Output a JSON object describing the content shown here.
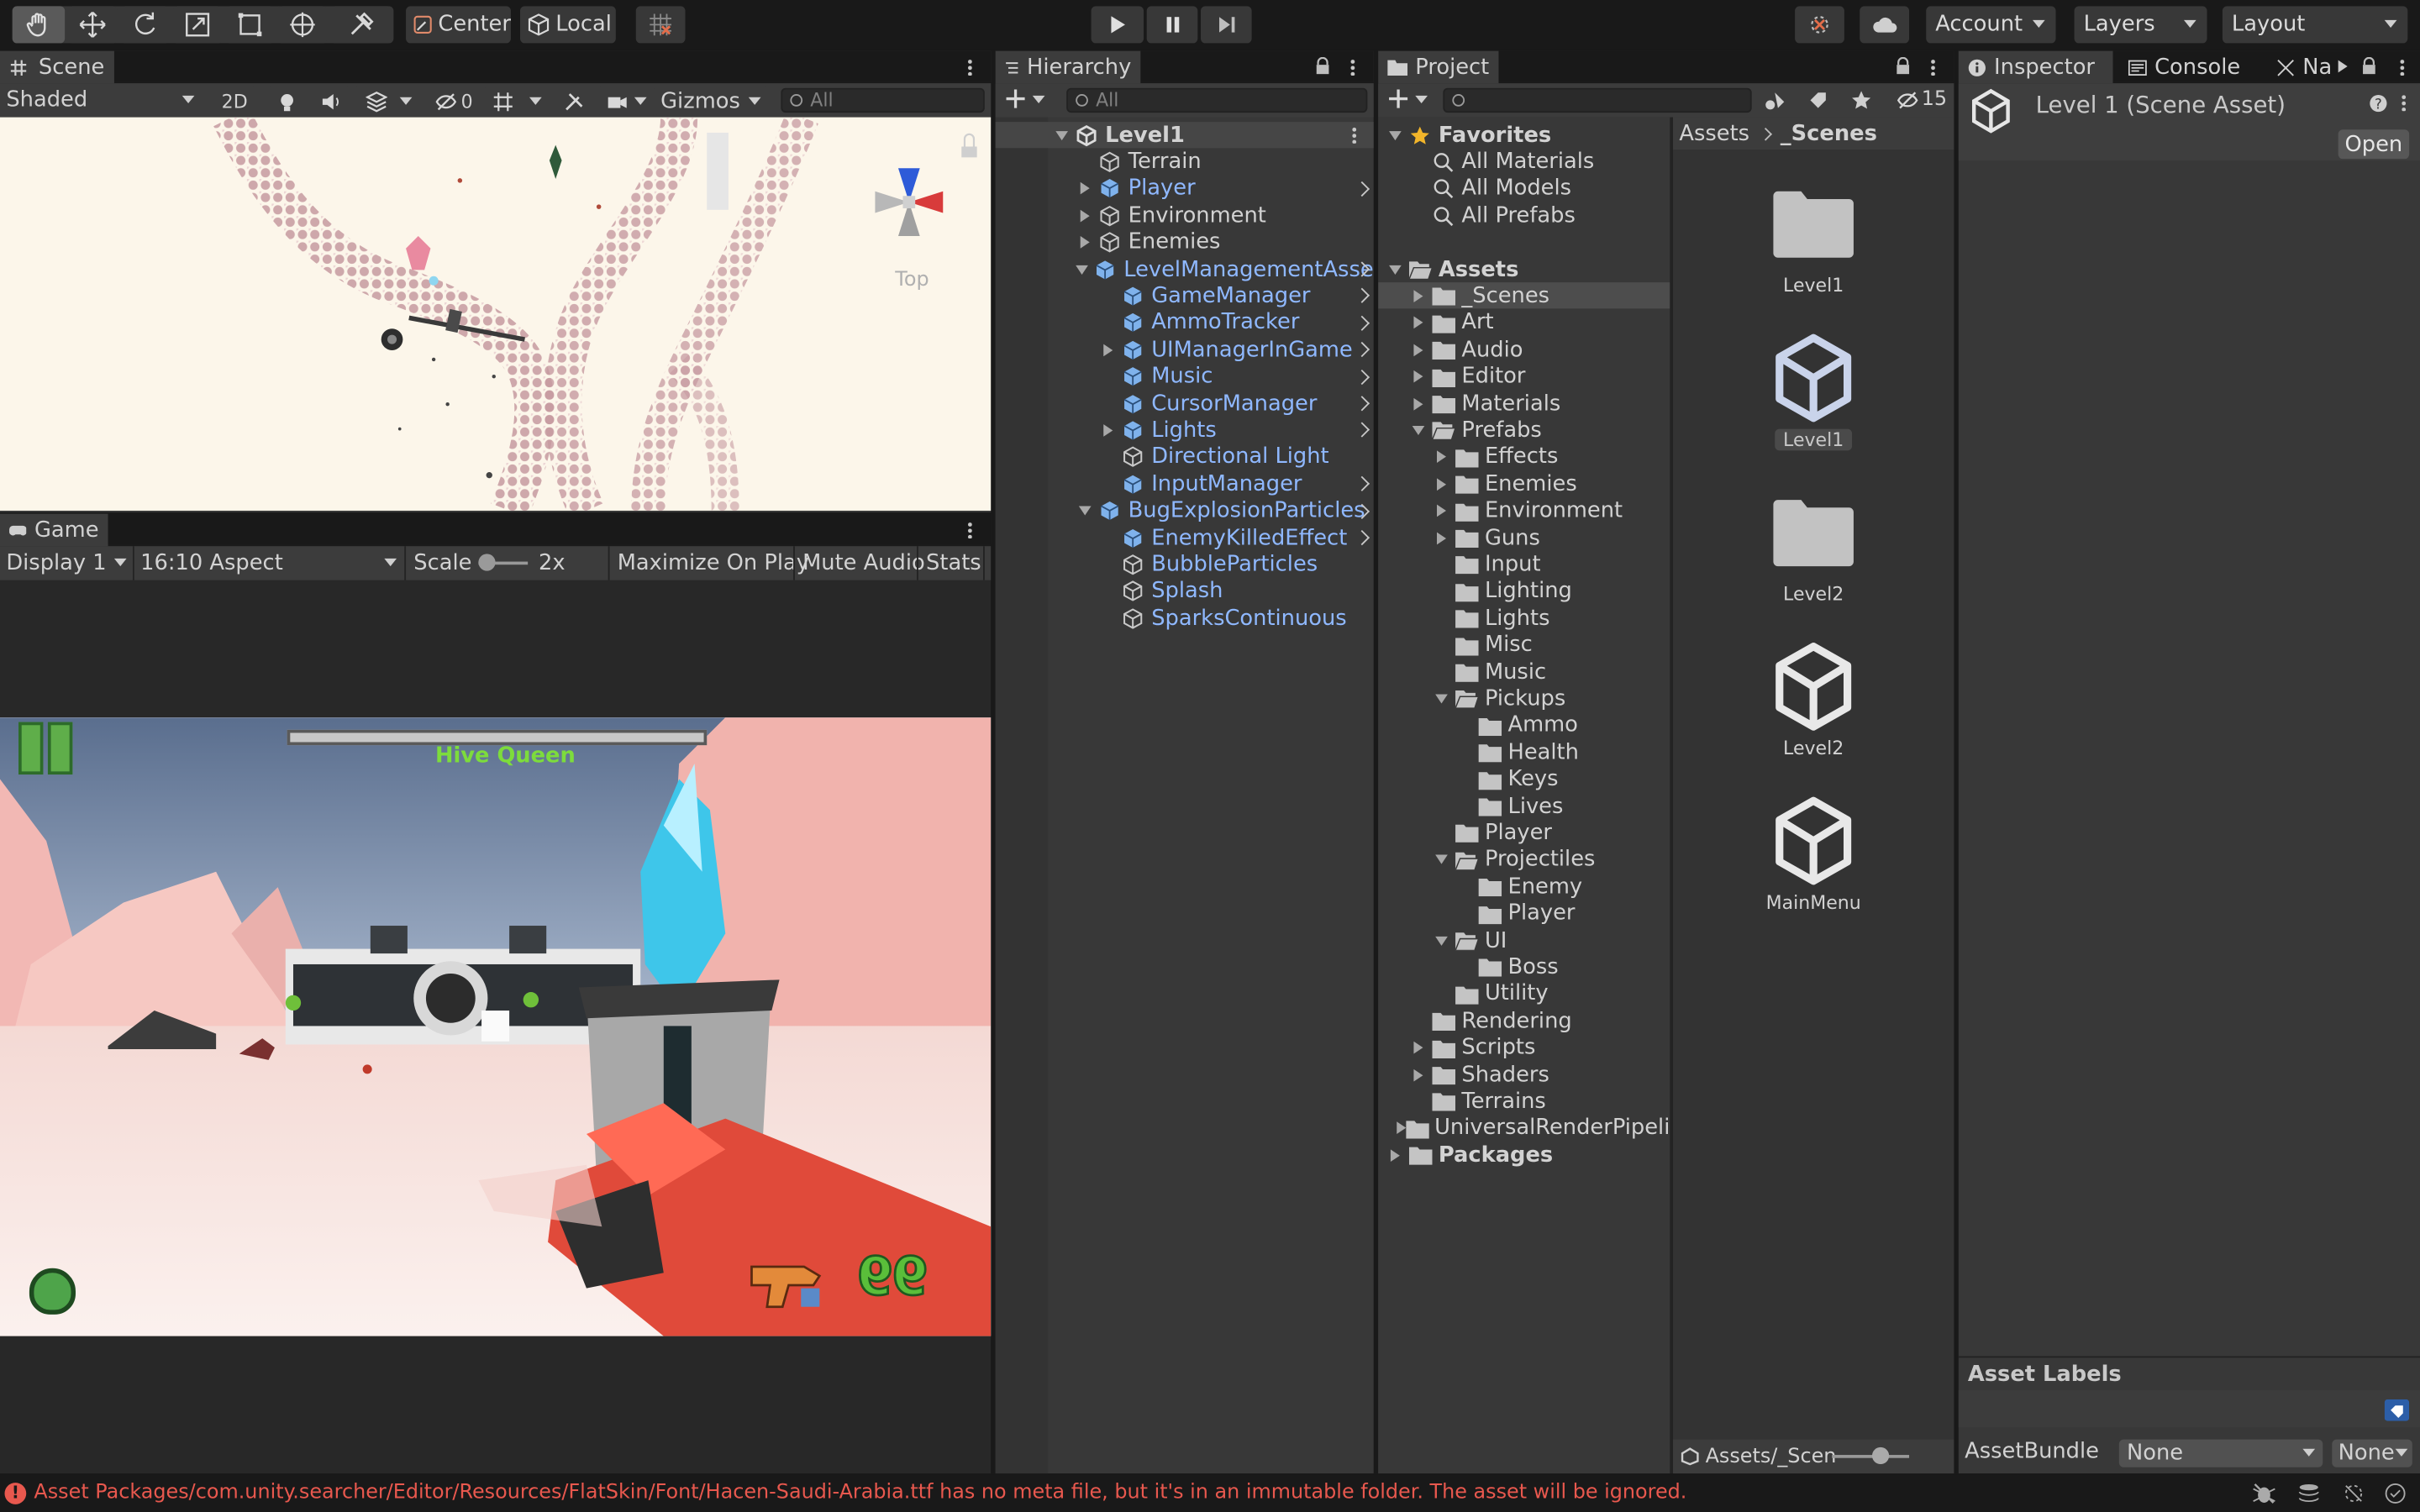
{
  "toolbar": {
    "pivot": "Center",
    "space": "Local",
    "account": "Account",
    "layers": "Layers",
    "layout": "Layout"
  },
  "scene": {
    "tab": "Scene",
    "shading": "Shaded",
    "mode_2d": "2D",
    "hidden_count": "0",
    "gizmos": "Gizmos",
    "search_placeholder": "All",
    "gizmo_label": "Top"
  },
  "game": {
    "tab": "Game",
    "display": "Display 1",
    "aspect": "16:10 Aspect",
    "scale_label": "Scale",
    "scale_value": "2x",
    "maximize": "Maximize On Play",
    "mute": "Mute Audio",
    "stats": "Stats",
    "boss_name": "Hive Queen",
    "ammo": "99"
  },
  "hierarchy": {
    "tab": "Hierarchy",
    "search_placeholder": "All",
    "items": [
      {
        "label": "Level1",
        "depth": 0,
        "icon": "unity-scene-icon",
        "expanded": true,
        "bold": true,
        "kebab": true
      },
      {
        "label": "Terrain",
        "depth": 1,
        "icon": "gameobject-icon"
      },
      {
        "label": "Player",
        "depth": 1,
        "icon": "prefab-icon",
        "collapsed": true,
        "blue": true,
        "chevron": true
      },
      {
        "label": "Environment",
        "depth": 1,
        "icon": "gameobject-icon",
        "collapsed": true
      },
      {
        "label": "Enemies",
        "depth": 1,
        "icon": "gameobject-icon",
        "collapsed": true
      },
      {
        "label": "LevelManagementAsse",
        "depth": 1,
        "icon": "prefab-icon",
        "expanded": true,
        "blue": true,
        "chevron": true
      },
      {
        "label": "GameManager",
        "depth": 2,
        "icon": "prefab-icon",
        "blue": true,
        "chevron": true
      },
      {
        "label": "AmmoTracker",
        "depth": 2,
        "icon": "prefab-icon",
        "blue": true,
        "chevron": true
      },
      {
        "label": "UIManagerInGame",
        "depth": 2,
        "icon": "prefab-icon",
        "collapsed": true,
        "blue": true,
        "chevron": true
      },
      {
        "label": "Music",
        "depth": 2,
        "icon": "prefab-icon",
        "blue": true,
        "chevron": true
      },
      {
        "label": "CursorManager",
        "depth": 2,
        "icon": "prefab-icon",
        "blue": true,
        "chevron": true
      },
      {
        "label": "Lights",
        "depth": 2,
        "icon": "prefab-icon",
        "collapsed": true,
        "blue": true,
        "chevron": true
      },
      {
        "label": "Directional Light",
        "depth": 2,
        "icon": "gameobject-icon",
        "blue": true
      },
      {
        "label": "InputManager",
        "depth": 2,
        "icon": "prefab-icon",
        "blue": true,
        "chevron": true
      },
      {
        "label": "BugExplosionParticles",
        "depth": 1,
        "icon": "prefab-icon",
        "expanded": true,
        "blue": true,
        "chevron": true
      },
      {
        "label": "EnemyKilledEffect",
        "depth": 2,
        "icon": "prefab-icon",
        "blue": true,
        "chevron": true
      },
      {
        "label": "BubbleParticles",
        "depth": 2,
        "icon": "gameobject-icon",
        "blue": true
      },
      {
        "label": "Splash",
        "depth": 2,
        "icon": "gameobject-icon",
        "blue": true
      },
      {
        "label": "SparksContinuous",
        "depth": 2,
        "icon": "gameobject-icon",
        "blue": true
      }
    ]
  },
  "project": {
    "tab": "Project",
    "hidden_count": "15",
    "breadcrumb": [
      "Assets",
      "_Scenes"
    ],
    "footer_path": "Assets/_Scen",
    "tree": [
      {
        "label": "Favorites",
        "depth": 0,
        "icon": "star-icon",
        "expanded": true,
        "bold": true
      },
      {
        "label": "All Materials",
        "depth": 1,
        "icon": "search-icon"
      },
      {
        "label": "All Models",
        "depth": 1,
        "icon": "search-icon"
      },
      {
        "label": "All Prefabs",
        "depth": 1,
        "icon": "search-icon"
      },
      {
        "label": "",
        "depth": 0,
        "icon": "none"
      },
      {
        "label": "Assets",
        "depth": 0,
        "icon": "folder-open-icon",
        "expanded": true,
        "bold": true
      },
      {
        "label": "_Scenes",
        "depth": 1,
        "icon": "folder-icon",
        "collapsed": true,
        "selected": true
      },
      {
        "label": "Art",
        "depth": 1,
        "icon": "folder-icon",
        "collapsed": true
      },
      {
        "label": "Audio",
        "depth": 1,
        "icon": "folder-icon",
        "collapsed": true
      },
      {
        "label": "Editor",
        "depth": 1,
        "icon": "folder-icon",
        "collapsed": true
      },
      {
        "label": "Materials",
        "depth": 1,
        "icon": "folder-icon",
        "collapsed": true
      },
      {
        "label": "Prefabs",
        "depth": 1,
        "icon": "folder-open-icon",
        "expanded": true
      },
      {
        "label": "Effects",
        "depth": 2,
        "icon": "folder-icon",
        "collapsed": true
      },
      {
        "label": "Enemies",
        "depth": 2,
        "icon": "folder-icon",
        "collapsed": true
      },
      {
        "label": "Environment",
        "depth": 2,
        "icon": "folder-icon",
        "collapsed": true
      },
      {
        "label": "Guns",
        "depth": 2,
        "icon": "folder-icon",
        "collapsed": true
      },
      {
        "label": "Input",
        "depth": 2,
        "icon": "folder-icon"
      },
      {
        "label": "Lighting",
        "depth": 2,
        "icon": "folder-icon"
      },
      {
        "label": "Lights",
        "depth": 2,
        "icon": "folder-icon"
      },
      {
        "label": "Misc",
        "depth": 2,
        "icon": "folder-icon"
      },
      {
        "label": "Music",
        "depth": 2,
        "icon": "folder-icon"
      },
      {
        "label": "Pickups",
        "depth": 2,
        "icon": "folder-open-icon",
        "expanded": true
      },
      {
        "label": "Ammo",
        "depth": 3,
        "icon": "folder-icon"
      },
      {
        "label": "Health",
        "depth": 3,
        "icon": "folder-icon"
      },
      {
        "label": "Keys",
        "depth": 3,
        "icon": "folder-icon"
      },
      {
        "label": "Lives",
        "depth": 3,
        "icon": "folder-icon"
      },
      {
        "label": "Player",
        "depth": 2,
        "icon": "folder-icon"
      },
      {
        "label": "Projectiles",
        "depth": 2,
        "icon": "folder-open-icon",
        "expanded": true
      },
      {
        "label": "Enemy",
        "depth": 3,
        "icon": "folder-icon"
      },
      {
        "label": "Player",
        "depth": 3,
        "icon": "folder-icon"
      },
      {
        "label": "UI",
        "depth": 2,
        "icon": "folder-open-icon",
        "expanded": true
      },
      {
        "label": "Boss",
        "depth": 3,
        "icon": "folder-icon"
      },
      {
        "label": "Utility",
        "depth": 2,
        "icon": "folder-icon"
      },
      {
        "label": "Rendering",
        "depth": 1,
        "icon": "folder-icon"
      },
      {
        "label": "Scripts",
        "depth": 1,
        "icon": "folder-icon",
        "collapsed": true
      },
      {
        "label": "Shaders",
        "depth": 1,
        "icon": "folder-icon",
        "collapsed": true
      },
      {
        "label": "Terrains",
        "depth": 1,
        "icon": "folder-icon"
      },
      {
        "label": "UniversalRenderPipeli",
        "depth": 1,
        "icon": "folder-icon",
        "collapsed": true
      },
      {
        "label": "Packages",
        "depth": 0,
        "icon": "folder-icon",
        "collapsed": true,
        "bold": true
      }
    ],
    "assets": [
      {
        "label": "Level1",
        "icon": "folder-icon"
      },
      {
        "label": "Level1",
        "icon": "unity-scene-icon",
        "selected": true
      },
      {
        "label": "Level2",
        "icon": "folder-icon"
      },
      {
        "label": "Level2",
        "icon": "unity-scene-icon"
      },
      {
        "label": "MainMenu",
        "icon": "unity-scene-icon"
      }
    ]
  },
  "inspector": {
    "tab": "Inspector",
    "console_tab": "Console",
    "nav_tab": "Na",
    "title": "Level 1 (Scene Asset)",
    "open_button": "Open",
    "asset_labels": "Asset Labels",
    "asset_bundle_label": "AssetBundle",
    "asset_bundle_value": "None",
    "asset_variant_value": "None"
  },
  "status": {
    "message": "Asset Packages/com.unity.searcher/Editor/Resources/FlatSkin/Font/Hacen-Saudi-Arabia.ttf has no meta file, but it's in an immutable folder. The asset will be ignored."
  },
  "colors": {
    "prefab_blue": "#8fb8ff",
    "error_red": "#e8584e",
    "boss_green": "#7ddc3c",
    "selection": "#4d4d4d"
  }
}
